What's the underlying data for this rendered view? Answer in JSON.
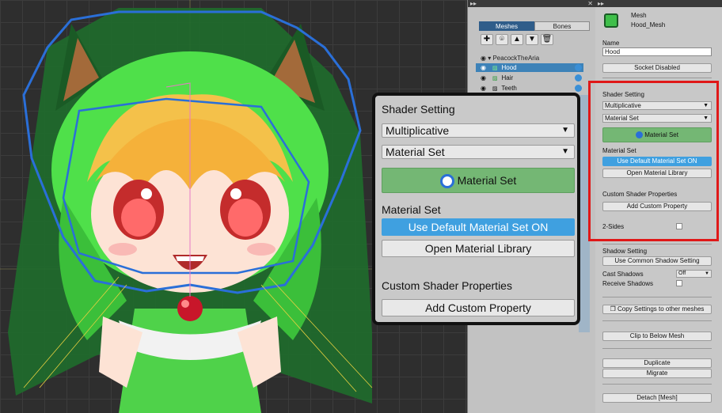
{
  "hierarchy": {
    "tabs": [
      "Meshes",
      "Bones"
    ],
    "icon_buttons": [
      "✚",
      "⌾",
      "▲",
      "▼",
      "🗑"
    ],
    "root": "PeacockTheAria",
    "items": [
      {
        "label": "Hood",
        "selected": true
      },
      {
        "label": "Hair",
        "selected": false
      },
      {
        "label": "Teeth",
        "selected": false
      }
    ]
  },
  "inspector": {
    "header_type": "Mesh",
    "header_name": "Hood_Mesh",
    "name_label": "Name",
    "name_value": "Hood",
    "socket_button": "Socket Disabled",
    "shader_setting_label": "Shader Setting",
    "shader_mode": "Multiplicative",
    "material_set_select": "Material Set",
    "material_set_button": "Material Set",
    "material_set_label": "Material Set",
    "use_default_button": "Use Default Material Set ON",
    "open_library_button": "Open Material Library",
    "custom_props_label": "Custom Shader Properties",
    "add_custom_button": "Add Custom Property",
    "two_sides_label": "2-Sides",
    "shadow_setting_label": "Shadow Setting",
    "use_common_shadow_button": "Use Common Shadow Setting",
    "cast_shadows_label": "Cast Shadows",
    "cast_shadows_value": "Off",
    "receive_shadows_label": "Receive Shadows",
    "copy_settings_button": "Copy Settings to other meshes",
    "clip_button": "Clip to Below Mesh",
    "duplicate_button": "Duplicate",
    "migrate_button": "Migrate",
    "detach_button": "Detach [Mesh]"
  },
  "zoom": {
    "shader_setting": "Shader Setting",
    "shader_mode": "Multiplicative",
    "material_set_select": "Material Set",
    "material_set_button": "Material Set",
    "material_set_label": "Material Set",
    "use_default_button": "Use Default Material Set ON",
    "open_library_button": "Open Material Library",
    "custom_props_label": "Custom Shader Properties",
    "add_custom_button": "Add Custom Property"
  },
  "colors": {
    "highlight_red": "#e01818",
    "selection_blue": "#3d82b8",
    "button_blue": "#3fa0e0",
    "button_green": "#74b774",
    "hood_green": "#1f6b2c",
    "hair_green": "#4fe04a"
  }
}
